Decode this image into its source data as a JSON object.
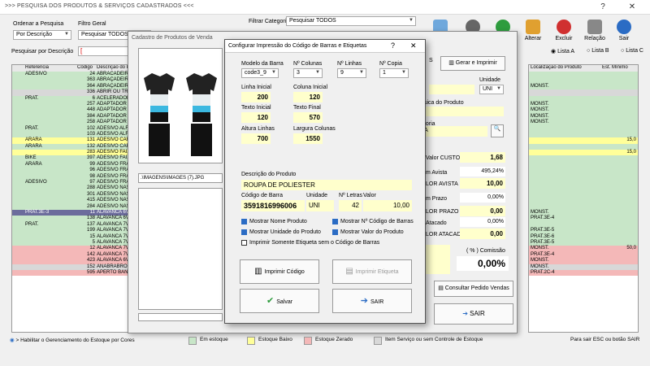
{
  "window": {
    "title": ">>> PESQUISA DOS PRODUTOS & SERVIÇOS CADASTRADOS <<<",
    "help": "?",
    "close": "✕"
  },
  "filters": {
    "ordenar_label": "Ordenar a Pesquisa",
    "ordenar_value": "Por Descrição",
    "filtro_label": "Filtro Geral",
    "filtro_value": "Pesquisar TODOS",
    "categoria_label": "Filtrar Categoria",
    "categoria_value": "Pesquisar TODOS",
    "pesquisar_label": "Pesquisar por Descrição",
    "lista_a": "Lista A",
    "lista_b": "Lista B",
    "lista_c": "Lista C"
  },
  "toolbar": {
    "alterar": "Alterar",
    "excluir": "Excluir",
    "relacao": "Relação",
    "sair": "Sair"
  },
  "grid": {
    "headers": [
      "Referencia",
      "Código",
      "Descrição do P"
    ],
    "rows": [
      {
        "ref": "ADESIVO",
        "cod": "24",
        "desc": "ABRACADEIRA",
        "c": "g"
      },
      {
        "ref": "",
        "cod": "363",
        "desc": "ABRAÇADEIRA",
        "c": "g"
      },
      {
        "ref": "",
        "cod": "364",
        "desc": "ABRAÇADEIRA",
        "c": "g"
      },
      {
        "ref": "",
        "cod": "336",
        "desc": "ABRIR OU TRO",
        "c": "gr"
      },
      {
        "ref": "PRAT.",
        "cod": "6",
        "desc": "ACELERADOR",
        "c": "g"
      },
      {
        "ref": "",
        "cod": "257",
        "desc": "ADAPTADOR 2",
        "c": "g"
      },
      {
        "ref": "",
        "cod": "448",
        "desc": "ADAPTADOR 2",
        "c": "g"
      },
      {
        "ref": "",
        "cod": "384",
        "desc": "ADAPTADOR 2",
        "c": "g"
      },
      {
        "ref": "",
        "cod": "258",
        "desc": "ADAPTADOR 2",
        "c": "g"
      },
      {
        "ref": "PRAT.",
        "cod": "102",
        "desc": "ADESIVO ALFA",
        "c": "g"
      },
      {
        "ref": "",
        "cod": "103",
        "desc": "ADESIVO ALFA",
        "c": "g"
      },
      {
        "ref": "ARARA",
        "cod": "131",
        "desc": "ADESIVO CAR",
        "c": "y"
      },
      {
        "ref": "ARARA",
        "cod": "132",
        "desc": "ADESIVO CAR",
        "c": "g"
      },
      {
        "ref": "",
        "cod": "283",
        "desc": "ADESIVO FAIX",
        "c": "y"
      },
      {
        "ref": "BIKE",
        "cod": "397",
        "desc": "ADESIVO FAIX",
        "c": "g"
      },
      {
        "ref": "ARARA",
        "cod": "99",
        "desc": "ADESIVO FRAS",
        "c": "g"
      },
      {
        "ref": "",
        "cod": "96",
        "desc": "ADESIVO FRAS",
        "c": "g"
      },
      {
        "ref": "",
        "cod": "98",
        "desc": "ADESIVO FRAS",
        "c": "g"
      },
      {
        "ref": "ADESIVO",
        "cod": "97",
        "desc": "ADESIVO FRAS",
        "c": "g"
      },
      {
        "ref": "",
        "cod": "288",
        "desc": "ADESIVO NAS",
        "c": "g"
      },
      {
        "ref": "",
        "cod": "301",
        "desc": "ADESIVO NAS",
        "c": "g"
      },
      {
        "ref": "",
        "cod": "415",
        "desc": "ADESIVO NAS",
        "c": "g"
      },
      {
        "ref": "",
        "cod": "284",
        "desc": "ADESIVO NAS",
        "c": "g"
      },
      {
        "ref": "PRAT.3E-3",
        "cod": "11",
        "desc": "ALAVANCA 6V",
        "c": "sel-row"
      },
      {
        "ref": "",
        "cod": "138",
        "desc": "ALAVANCA 6V",
        "c": "g"
      },
      {
        "ref": "PRAT.",
        "cod": "137",
        "desc": "ALAVANCA 7V",
        "c": "g"
      },
      {
        "ref": "",
        "cod": "199",
        "desc": "ALAVANCA 7V",
        "c": "g"
      },
      {
        "ref": "",
        "cod": "15",
        "desc": "ALAVANCA 7V",
        "c": "g"
      },
      {
        "ref": "",
        "cod": "5",
        "desc": "ALAVANCA 7V",
        "c": "g"
      },
      {
        "ref": "",
        "cod": "12",
        "desc": "ALAVANCA 7V",
        "c": "r"
      },
      {
        "ref": "",
        "cod": "142",
        "desc": "ALAVANCA 7V",
        "c": "r"
      },
      {
        "ref": "",
        "cod": "423",
        "desc": "ALAVANCA 6V",
        "c": "r"
      },
      {
        "ref": "",
        "cod": "152",
        "desc": "ANABRABRO",
        "c": "gr"
      },
      {
        "ref": "",
        "cod": "595",
        "desc": "APERTO BANC",
        "c": "r"
      }
    ]
  },
  "rightgrid": {
    "headers": [
      "Localização do Produto",
      "Est. Mínimo"
    ],
    "rows": [
      {
        "loc": "",
        "min": "",
        "c": "g"
      },
      {
        "loc": "",
        "min": "",
        "c": "g"
      },
      {
        "loc": "MONST.",
        "min": "",
        "c": "g"
      },
      {
        "loc": "",
        "min": "",
        "c": "gr"
      },
      {
        "loc": "",
        "min": "",
        "c": "g"
      },
      {
        "loc": "MONST.",
        "min": "",
        "c": "g"
      },
      {
        "loc": "MONST.",
        "min": "",
        "c": "g"
      },
      {
        "loc": "MONST.",
        "min": "",
        "c": "g"
      },
      {
        "loc": "MONST.",
        "min": "",
        "c": "g"
      },
      {
        "loc": "",
        "min": "",
        "c": "g"
      },
      {
        "loc": "",
        "min": "",
        "c": "g"
      },
      {
        "loc": "",
        "min": "15,0",
        "c": "y"
      },
      {
        "loc": "",
        "min": "",
        "c": "g"
      },
      {
        "loc": "",
        "min": "15,0",
        "c": "y"
      },
      {
        "loc": "",
        "min": "",
        "c": "g"
      },
      {
        "loc": "",
        "min": "",
        "c": "g"
      },
      {
        "loc": "",
        "min": "",
        "c": "g"
      },
      {
        "loc": "",
        "min": "",
        "c": "g"
      },
      {
        "loc": "",
        "min": "",
        "c": "g"
      },
      {
        "loc": "",
        "min": "",
        "c": "g"
      },
      {
        "loc": "",
        "min": "",
        "c": "g"
      },
      {
        "loc": "",
        "min": "",
        "c": "g"
      },
      {
        "loc": "",
        "min": "",
        "c": "g"
      },
      {
        "loc": "MONST.",
        "min": "",
        "c": "g"
      },
      {
        "loc": "PRAT.3E-4",
        "min": "",
        "c": "g"
      },
      {
        "loc": "",
        "min": "",
        "c": "g"
      },
      {
        "loc": "PRAT.3E-5",
        "min": "",
        "c": "g"
      },
      {
        "loc": "PRAT.3E-6",
        "min": "",
        "c": "g"
      },
      {
        "loc": "PRAT.3E-5",
        "min": "",
        "c": "g"
      },
      {
        "loc": "MONST.",
        "min": "50,0",
        "c": "r"
      },
      {
        "loc": "PRAT.3E-4",
        "min": "",
        "c": "r"
      },
      {
        "loc": "MONST.",
        "min": "",
        "c": "r"
      },
      {
        "loc": "MONST.",
        "min": "",
        "c": "gr"
      },
      {
        "loc": "PRAT.2C-4",
        "min": "",
        "c": "r"
      }
    ]
  },
  "cadastro": {
    "title": "Cadastro de Produtos de Venda",
    "image_path": ".\\IMAGENS\\IMAGES (7).JPG",
    "gerar_button": "Gerar e Imprimir",
    "unidade_label": "Unidade",
    "unidade_value": "UNI",
    "fisica_label": "ísica do Produto",
    "categoria_label": "goria",
    "categoria_value": "A",
    "custo_label": "Valor CUSTO",
    "custo_value": "1,68",
    "avista_label": "m Avista",
    "avista_pct": "495,24%",
    "valor_avista_label": "LOR AVISTA",
    "valor_avista": "10,00",
    "prazo_label": "m Prazo",
    "prazo_pct": "0,00%",
    "valor_prazo_label": "LOR PRAZO",
    "valor_prazo": "0,00",
    "atacado_label": "Atacado",
    "atacado_pct": "0,00%",
    "valor_atacado_label": "LOR ATACADO",
    "valor_atacado": "0,00",
    "comissao_label": "( % ) Comissão",
    "comissao_value": "0,00%",
    "consultar_button": "Consultar Pedido Vendas",
    "sair_button": "SAIR",
    "number_fragment": "S"
  },
  "dialog": {
    "title": "Configurar Impressão do Código de Barras e Etiquetas",
    "help": "?",
    "close": "✕",
    "modelo_label": "Modelo da Barra",
    "modelo_value": "code3_9",
    "colunas_label": "Nº Colunas",
    "colunas_value": "3",
    "linhas_label": "Nº Linhas",
    "linhas_value": "9",
    "copia_label": "Nº Copia",
    "copia_value": "1",
    "linha_inicial_label": "Linha Inicial",
    "linha_inicial": "200",
    "coluna_inicial_label": "Coluna Inicial",
    "coluna_inicial": "120",
    "texto_inicial_label": "Texto Inicial",
    "texto_inicial": "120",
    "texto_final_label": "Texto Final",
    "texto_final": "570",
    "altura_label": "Altura Linhas",
    "altura": "700",
    "largura_label": "Largura Colunas",
    "largura": "1550",
    "descricao_label": "Descrição do Produto",
    "descricao": "ROUPA DE POLIESTER",
    "codigo_label": "Código de Barra",
    "codigo": "3591816996006",
    "unidade_label": "Unidade",
    "unidade": "UNI",
    "letras_label": "Nº Letras",
    "letras": "42",
    "valor_label": "Valor",
    "valor": "10,00",
    "chk_nome": "Mostrar Nome Produto",
    "chk_num_codigo": "Mostrar Nº Código de Barras",
    "chk_unidade": "Mostrar Unidade do Produto",
    "chk_valor": "Mostrar Valor do Produto",
    "chk_somente": "Imprimir Somente Etiqueta sem o Código de Barras",
    "imprimir_codigo": "Imprimir Código",
    "imprimir_etiqueta": "Imprimir Etiqueta",
    "salvar": "Salvar",
    "sair": "SAIR"
  },
  "statusbar": {
    "habilitar": "> Habilitar o Gerenciamento do Estoque por Cores",
    "em_estoque": "Em estoque",
    "estoque_baixo": "Estoque Baixo",
    "estoque_zerado": "Estoque Zerado",
    "item_servico": "Item Serviço ou sem Controle de Estoque",
    "sair_hint": "Para sair ESC ou botão SAIR"
  },
  "colors": {
    "em_estoque": "#c8e6c8",
    "estoque_baixo": "#ffff99",
    "estoque_zerado": "#f4b8b8",
    "item_servico": "#d8d8d8",
    "accent": "#2b6cc4"
  }
}
